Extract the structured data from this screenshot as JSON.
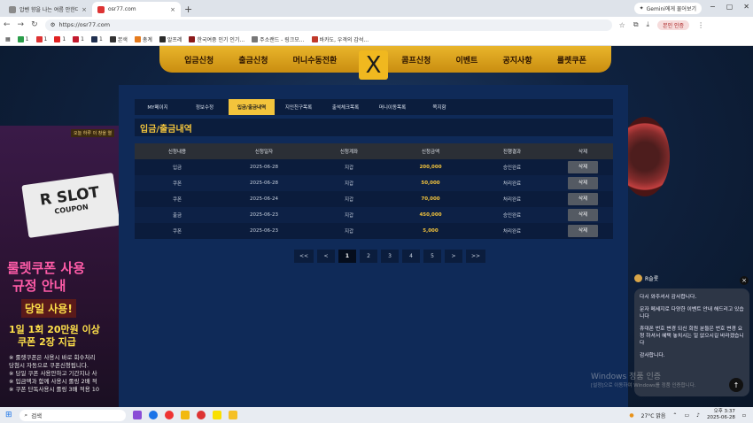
{
  "browser": {
    "tabs": [
      {
        "title": "압벤 향을 나는 여름 안한다이",
        "active": false
      },
      {
        "title": "osr77.com",
        "active": true
      }
    ],
    "new_tab": "+",
    "gemini": "Gemini에게 물어보기",
    "url": "https://osr77.com",
    "profile": "본인 인증",
    "bookmarks": [
      "1",
      "1",
      "1",
      "1",
      "1",
      "본색",
      "총계",
      "알프레",
      "한국여중 인기 인기...",
      "주소랜드 - 링크모...",
      "바카도, 우격의 감석..."
    ]
  },
  "topnav": [
    "입금신청",
    "출금신청",
    "머니수동전환",
    "쿠폰",
    "콤프신청",
    "이벤트",
    "공지사항",
    "룰렛쿠폰"
  ],
  "close_icon": "X",
  "promo": {
    "notice": "오늘 하루 이 창을 열",
    "coupon_big": "R SLOT",
    "coupon_small": "COUPON",
    "line1": "룰렛쿠폰 사용",
    "line2": "규정 안내",
    "line3": "당일 사용!",
    "line4": "1일 1회 20만원 이상",
    "line5": "쿠폰 2장 지급",
    "notes": [
      "※ 룰렛쿠폰은 사용시 바로 회수처리",
      "당첨시 자동으로 쿠폰신청됩니다.",
      "※ 당일 쿠폰 사용안하고 기간지나 사",
      "※ 입금액과 함께 사용시 롤링 2배 적",
      "※ 쿠폰 단독사용시 롤링 3배 적용 10"
    ]
  },
  "subnav": [
    {
      "label": "MY페이지",
      "active": false
    },
    {
      "label": "정보수정",
      "active": false
    },
    {
      "label": "입금/출금내역",
      "active": true
    },
    {
      "label": "지인친구목록",
      "active": false
    },
    {
      "label": "출석체크목록",
      "active": false
    },
    {
      "label": "머니이동목록",
      "active": false
    },
    {
      "label": "쪽지함",
      "active": false
    }
  ],
  "section_title": "입금/출금내역",
  "table": {
    "headers": [
      "신청내용",
      "신청일자",
      "신청계좌",
      "신청금액",
      "진행결과",
      "삭제"
    ],
    "rows": [
      {
        "type": "입금",
        "date": "2025-06-28",
        "account": "지갑",
        "amount": "200,000",
        "result": "승인완료",
        "action": "삭제"
      },
      {
        "type": "쿠폰",
        "date": "2025-06-28",
        "account": "지갑",
        "amount": "50,000",
        "result": "처리완료",
        "action": "삭제"
      },
      {
        "type": "쿠폰",
        "date": "2025-06-24",
        "account": "지갑",
        "amount": "70,000",
        "result": "처리완료",
        "action": "삭제"
      },
      {
        "type": "출금",
        "date": "2025-06-23",
        "account": "지갑",
        "amount": "450,000",
        "result": "승인완료",
        "action": "삭제"
      },
      {
        "type": "쿠폰",
        "date": "2025-06-23",
        "account": "지갑",
        "amount": "5,000",
        "result": "처리완료",
        "action": "삭제"
      }
    ]
  },
  "pager": [
    "<<",
    "<",
    "1",
    "2",
    "3",
    "4",
    "5",
    ">",
    ">>"
  ],
  "pager_active": "1",
  "chat": {
    "name": "R슬롯",
    "messages": [
      "다시 와주셔서 감사합니다.",
      "문자 메세지로 다양한 이벤트 안내 해드리고 있습니다",
      "휴대폰 번호 변경 되신 회원 분들은 번호 변경 요청 하셔서 혜택 놓치시는 일 없으시길 바라겠습니다",
      "감사합니다."
    ]
  },
  "watermark": {
    "line1": "Windows 정품 인증",
    "line2": "[설정]으로 이동하여 Windows를 정품 인증합니다."
  },
  "taskbar": {
    "search": "검색",
    "weather": "27°C 맑음",
    "time": "오후 3:37",
    "date": "2025-06-28"
  }
}
